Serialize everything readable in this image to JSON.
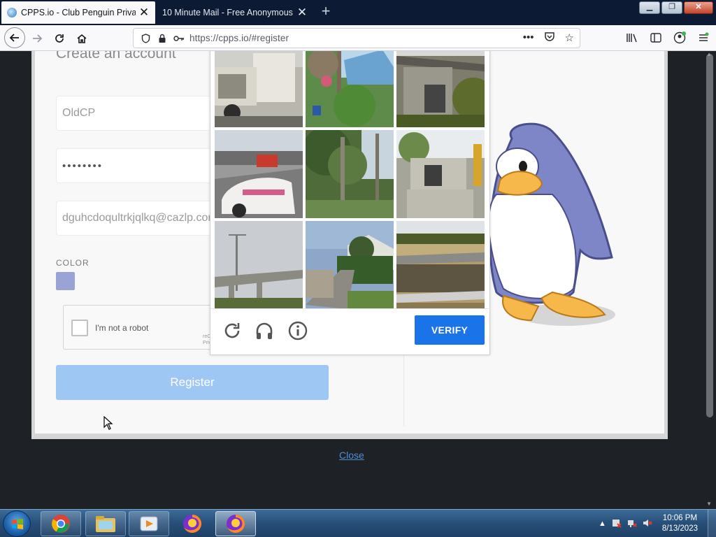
{
  "browser": {
    "tabs": [
      {
        "title": "CPPS.io - Club Penguin Private",
        "active": true
      },
      {
        "title": "10 Minute Mail - Free Anonymous",
        "active": false
      }
    ],
    "url": "https://cpps.io/#register",
    "tab_close_glyph": "✕",
    "newtab_glyph": "+"
  },
  "form": {
    "heading": "Create an account",
    "username_value": "OldCP",
    "password_value": "••••••••",
    "email_value": "dguhcdoqultrkjqlkq@cazlp.com",
    "color_label": "COLOR",
    "color_value": "#9aa3d6",
    "recaptcha_label": "I'm not a robot",
    "recaptcha_tiny_1": "reC",
    "recaptcha_tiny_2": "Priv",
    "register_label": "Register",
    "close_link": "Close"
  },
  "captcha": {
    "verify_label": "VERIFY",
    "tile_count": 9,
    "icons": [
      "reload-icon",
      "audio-icon",
      "info-icon"
    ]
  },
  "taskbar": {
    "clock_time": "10:06 PM",
    "clock_date": "8/13/2023",
    "apps": [
      "chrome-icon",
      "file-explorer-icon",
      "media-player-icon",
      "firefox-icon",
      "firefox-icon"
    ]
  },
  "colors": {
    "accent_blue": "#1a73e8",
    "register_button": "#9ec7f4",
    "penguin_blue": "#7e86c8"
  }
}
